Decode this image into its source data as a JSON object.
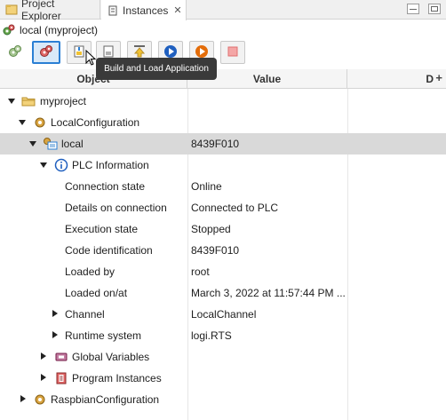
{
  "tabs": [
    {
      "label": "Project Explorer",
      "icon": "project-explorer-icon"
    },
    {
      "label": "Instances",
      "icon": "instances-icon",
      "close": "✕"
    }
  ],
  "header": {
    "title": "local (myproject)"
  },
  "toolbar": {
    "buttons": [
      {
        "name": "connect-button",
        "icon": "gears-icon"
      },
      {
        "name": "build-and-load-button",
        "icon": "gears-active-icon"
      },
      {
        "name": "load-button",
        "icon": "document-download-icon"
      },
      {
        "name": "save-button",
        "icon": "document-icon"
      },
      {
        "name": "upload-button",
        "icon": "arrow-up-icon"
      },
      {
        "name": "run-button",
        "icon": "play-blue-icon"
      },
      {
        "name": "run-cold-button",
        "icon": "play-orange-icon"
      },
      {
        "name": "stop-button",
        "icon": "stop-icon"
      }
    ],
    "tooltip": "Build and Load Application"
  },
  "table": {
    "headers": {
      "object": "Object",
      "value": "Value",
      "d": "D"
    },
    "add_column": "+",
    "rows": [
      {
        "label": "myproject",
        "value": "",
        "icon": "folder-icon",
        "twisty": "open"
      },
      {
        "label": "LocalConfiguration",
        "value": "",
        "icon": "configuration-gear-icon",
        "twisty": "open"
      },
      {
        "label": "local",
        "value": "8439F010",
        "icon": "resource-icon",
        "twisty": "open",
        "selected": true
      },
      {
        "label": "PLC Information",
        "value": "",
        "icon": "info-icon",
        "twisty": "open"
      },
      {
        "label": "Connection state",
        "value": "Online"
      },
      {
        "label": "Details on connection",
        "value": "Connected to PLC"
      },
      {
        "label": "Execution state",
        "value": "Stopped"
      },
      {
        "label": "Code identification",
        "value": "8439F010"
      },
      {
        "label": "Loaded by",
        "value": "root"
      },
      {
        "label": "Loaded on/at",
        "value": "March 3, 2022 at 11:57:44 PM ..."
      },
      {
        "label": "Channel",
        "value": "LocalChannel",
        "twisty": "closed"
      },
      {
        "label": "Runtime system",
        "value": "logi.RTS",
        "twisty": "closed"
      },
      {
        "label": "Global Variables",
        "value": "",
        "icon": "global-variables-icon",
        "twisty": "closed"
      },
      {
        "label": "Program Instances",
        "value": "",
        "icon": "program-instances-icon",
        "twisty": "closed"
      },
      {
        "label": "RaspbianConfiguration",
        "value": "",
        "icon": "configuration-gear-icon",
        "twisty": "closed"
      }
    ]
  },
  "colors": {
    "selected_row": "#d9d9d9",
    "tooltip_bg": "#3a3a3a",
    "active_button_border": "#2a7fd4"
  }
}
